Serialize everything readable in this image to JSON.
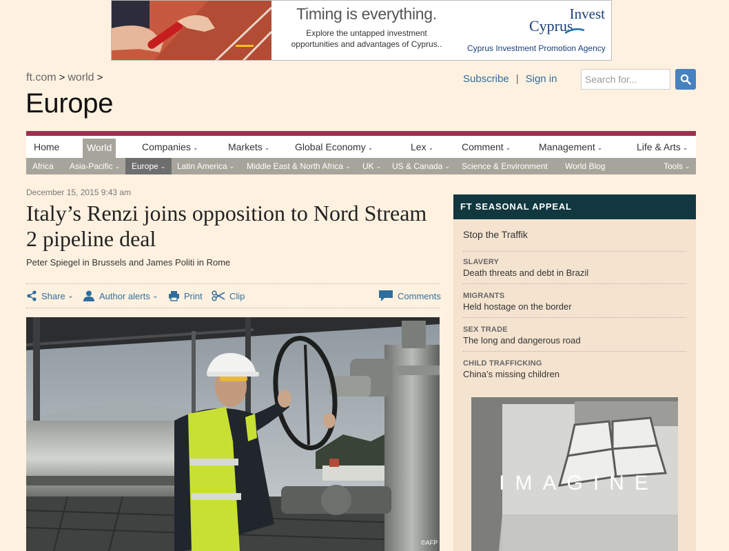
{
  "ad": {
    "headline": "Timing is everything.",
    "body_line1": "Explore the untapped investment",
    "body_line2": "opportunities and advantages of Cyprus..",
    "logo_word1": "Invest",
    "logo_word2": "Cyprus",
    "agency": "Cyprus Investment Promotion Agency"
  },
  "breadcrumb": {
    "items": [
      "ft.com",
      "world"
    ],
    "separator": ">"
  },
  "section_title": "Europe",
  "header": {
    "subscribe": "Subscribe",
    "divider": "|",
    "sign_in": "Sign in",
    "search_placeholder": "Search for..."
  },
  "nav": {
    "primary": [
      {
        "label": "Home",
        "caret": ""
      },
      {
        "label": "World",
        "caret": "",
        "active": true
      },
      {
        "label": "Companies",
        "caret": "⌄"
      },
      {
        "label": "Markets",
        "caret": "⌄"
      },
      {
        "label": "Global Economy",
        "caret": "⌄"
      },
      {
        "label": "Lex",
        "caret": "⌄"
      },
      {
        "label": "Comment",
        "caret": "⌄"
      },
      {
        "label": "Management",
        "caret": "⌄"
      },
      {
        "label": "Life & Arts",
        "caret": "⌄"
      }
    ],
    "secondary": [
      {
        "label": "Africa",
        "caret": ""
      },
      {
        "label": "Asia-Pacific",
        "caret": "⌄"
      },
      {
        "label": "Europe",
        "caret": "⌄",
        "active": true
      },
      {
        "label": "Latin America",
        "caret": "⌄"
      },
      {
        "label": "Middle East & North Africa",
        "caret": "⌄"
      },
      {
        "label": "UK",
        "caret": "⌄"
      },
      {
        "label": "US & Canada",
        "caret": "⌄"
      },
      {
        "label": "Science & Environment",
        "caret": ""
      },
      {
        "label": "World Blog",
        "caret": ""
      },
      {
        "label": "Tools",
        "caret": "⌄"
      }
    ]
  },
  "article": {
    "dateline": "December 15, 2015 9:43 am",
    "headline": "Italy’s Renzi joins opposition to Nord Stream 2 pipeline deal",
    "byline": "Peter Spiegel in Brussels and James Politi in Rome",
    "tools": {
      "share": "Share",
      "author_alerts": "Author alerts",
      "print": "Print",
      "clip": "Clip",
      "comments": "Comments"
    },
    "image_credit": "©AFP"
  },
  "sidebar": {
    "header": "FT SEASONAL APPEAL",
    "title": "Stop the Traffik",
    "stories": [
      {
        "category": "SLAVERY",
        "title": "Death threats and debt in Brazil"
      },
      {
        "category": "MIGRANTS",
        "title": "Held hostage on the border"
      },
      {
        "category": "SEX TRADE",
        "title": "The long and dangerous road"
      },
      {
        "category": "CHILD TRAFFICKING",
        "title": "China’s missing children"
      }
    ],
    "promo_text": "IMAGINE"
  },
  "colors": {
    "page_bg": "#fff1e0",
    "nav_rule": "#9e2f50",
    "subnav_bg": "#a7a59b",
    "link_blue": "#2e6e9e",
    "sidebar_head": "#11373f"
  }
}
